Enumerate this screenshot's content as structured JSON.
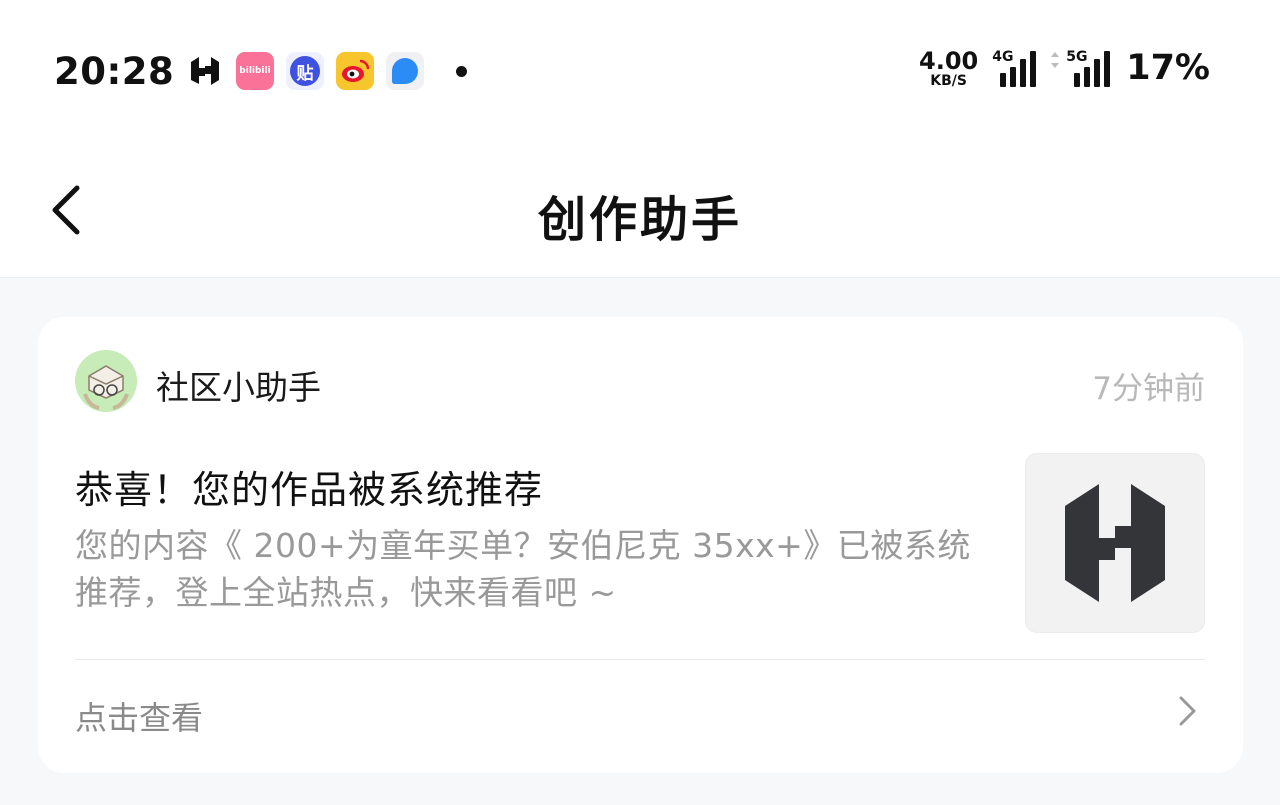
{
  "status_bar": {
    "time": "20:28",
    "app_icons": [
      "hupu-icon",
      "bilibili-icon",
      "tieba-icon",
      "weibo-icon",
      "browser-icon"
    ],
    "bilibili_text": "bilibili",
    "tieba_text": "贴",
    "net_speed_value": "4.00",
    "net_speed_unit": "KB/S",
    "sim1_label": "4G",
    "sim2_label": "5G",
    "battery": "17%"
  },
  "nav": {
    "title": "创作助手"
  },
  "message": {
    "sender": "社区小助手",
    "time": "7分钟前",
    "title": "恭喜！您的作品被系统推荐",
    "body": "您的内容《 200+为童年买单？安伯尼克 35xx+》已被系统推荐，登上全站热点，快来看看吧 ~",
    "view_label": "点击查看"
  },
  "colors": {
    "page_bg": "#f7f8fa",
    "card_bg": "#ffffff",
    "muted_text": "#999999",
    "time_text": "#b8b8b8",
    "bilibili_pink": "#fb7299",
    "tieba_blue": "#3f51e0",
    "weibo_yellow": "#f7c52c",
    "avatar_green": "#c7ecb8"
  }
}
